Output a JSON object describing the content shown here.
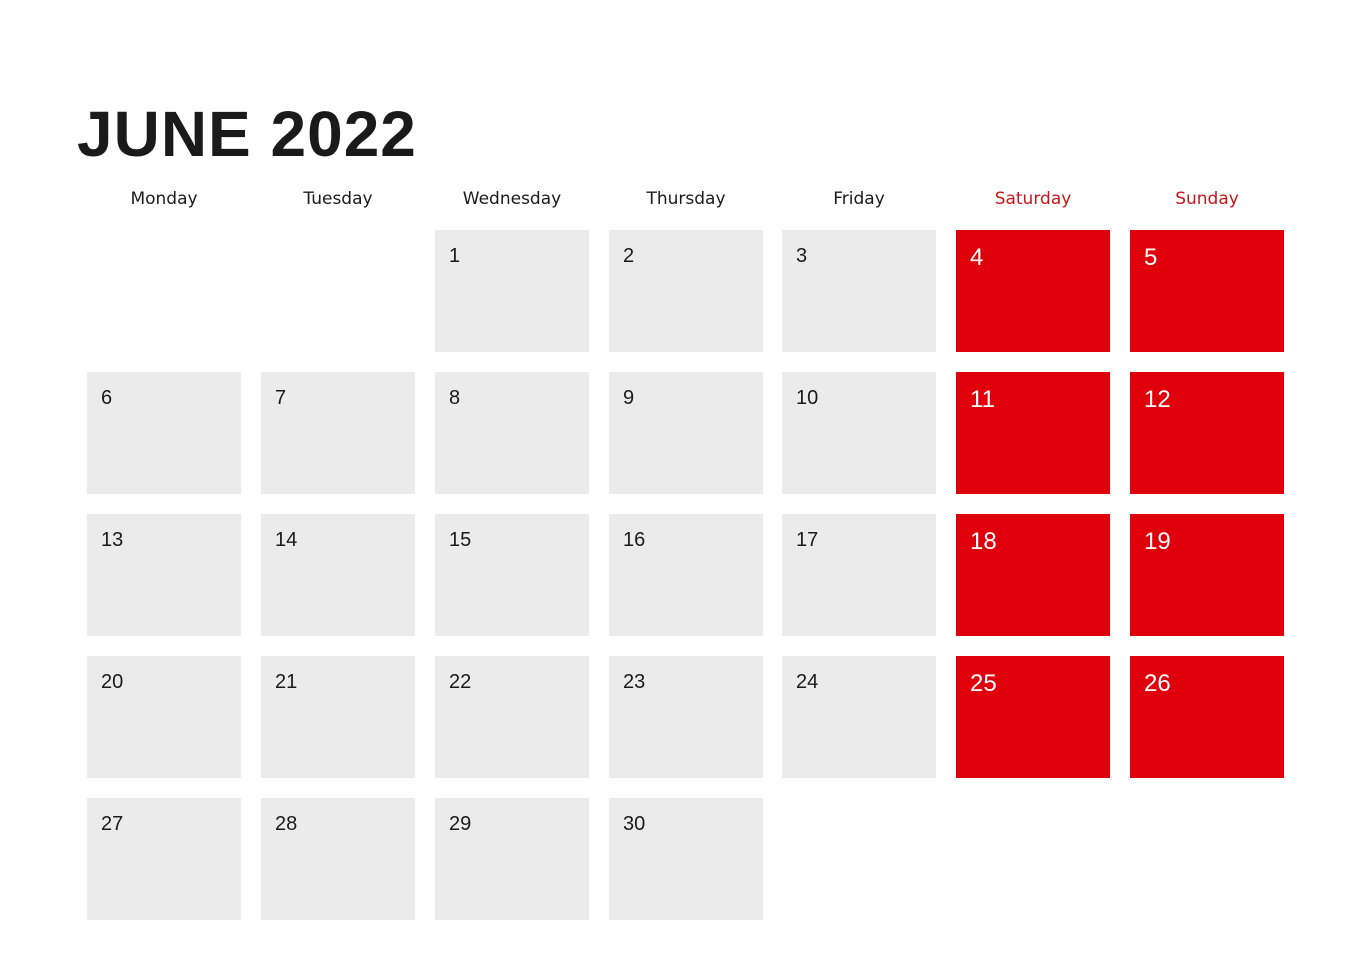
{
  "calendar": {
    "title": "JUNE 2022",
    "weekend_color": "#e0000b",
    "weekday_cell_color": "#ebebeb",
    "weekdays": [
      {
        "label": "Monday",
        "weekend": false
      },
      {
        "label": "Tuesday",
        "weekend": false
      },
      {
        "label": "Wednesday",
        "weekend": false
      },
      {
        "label": "Thursday",
        "weekend": false
      },
      {
        "label": "Friday",
        "weekend": false
      },
      {
        "label": "Saturday",
        "weekend": true
      },
      {
        "label": "Sunday",
        "weekend": true
      }
    ],
    "weeks": [
      [
        null,
        null,
        "1",
        "2",
        "3",
        "4",
        "5"
      ],
      [
        "6",
        "7",
        "8",
        "9",
        "10",
        "11",
        "12"
      ],
      [
        "13",
        "14",
        "15",
        "16",
        "17",
        "18",
        "19"
      ],
      [
        "20",
        "21",
        "22",
        "23",
        "24",
        "25",
        "26"
      ],
      [
        "27",
        "28",
        "29",
        "30",
        null,
        null,
        null
      ]
    ]
  }
}
